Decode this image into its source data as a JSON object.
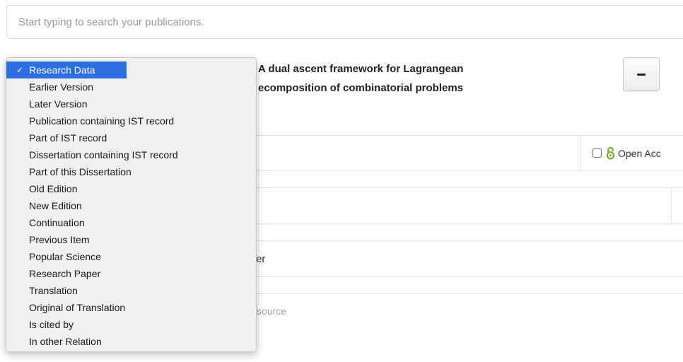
{
  "search": {
    "placeholder": "Start typing to search your publications."
  },
  "publication": {
    "title_line1": "A dual ascent framework for Lagrangean",
    "title_line2": "ecomposition of combinatorial problems"
  },
  "remove_button": {
    "icon": "minus-icon"
  },
  "open_access": {
    "label": "Open Acc",
    "icon": "open-access-icon",
    "icon_color": "#7ab32e",
    "checked": false
  },
  "form": {
    "row3_text": "er",
    "hint_text": "source"
  },
  "relation_dropdown": {
    "selected_index": 0,
    "highlight_color": "#2c6fe0",
    "check_symbol": "✓",
    "options": [
      "Research Data",
      "Earlier Version",
      "Later Version",
      "Publication containing IST record",
      "Part of IST record",
      "Dissertation containing IST record",
      "Part of this Dissertation",
      "Old Edition",
      "New Edition",
      "Continuation",
      "Previous Item",
      "Popular Science",
      "Research Paper",
      "Translation",
      "Original of Translation",
      "Is cited by",
      "In other Relation"
    ]
  }
}
